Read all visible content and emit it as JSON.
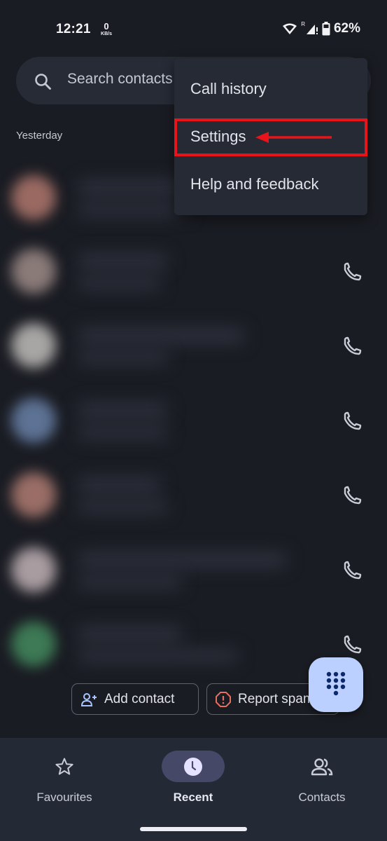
{
  "status_bar": {
    "time": "12:21",
    "net_speed_value": "0",
    "net_speed_unit": "KB/s",
    "roaming_indicator": "R",
    "battery_percent": "62%",
    "icons": [
      "wifi-icon",
      "signal-icon",
      "battery-icon"
    ]
  },
  "search": {
    "placeholder": "Search contacts"
  },
  "recents": {
    "section_label": "Yesterday",
    "rows": [
      {
        "avatar_color": "#9a6a62",
        "has_call_button": false
      },
      {
        "avatar_color": "#8a7a78",
        "has_call_button": true
      },
      {
        "avatar_color": "#a8a6a4",
        "has_call_button": true
      },
      {
        "avatar_color": "#5d7294",
        "has_call_button": true
      },
      {
        "avatar_color": "#9a6e66",
        "has_call_button": true
      },
      {
        "avatar_color": "#a89ca0",
        "has_call_button": true
      },
      {
        "avatar_color": "#3d7a55",
        "has_call_button": true
      }
    ]
  },
  "overflow_menu": {
    "items": [
      {
        "label": "Call history"
      },
      {
        "label": "Settings",
        "highlighted": true
      },
      {
        "label": "Help and feedback"
      }
    ]
  },
  "annotation": {
    "color": "#e8141a",
    "target": "Settings"
  },
  "chips": {
    "add_contact": "Add contact",
    "report_spam": "Report spam"
  },
  "fab": {
    "icon": "dialpad-icon",
    "color": "#bcd0ff"
  },
  "bottom_nav": {
    "items": [
      {
        "label": "Favourites",
        "icon": "star-icon",
        "active": false
      },
      {
        "label": "Recent",
        "icon": "clock-icon",
        "active": true
      },
      {
        "label": "Contacts",
        "icon": "people-icon",
        "active": false
      }
    ]
  },
  "colors": {
    "background": "#1a1c23",
    "surface": "#262b36",
    "menu": "#252a35",
    "nav_active_pill": "#464868",
    "text_primary": "#e2e4ea",
    "text_secondary": "#c5c8d2"
  }
}
